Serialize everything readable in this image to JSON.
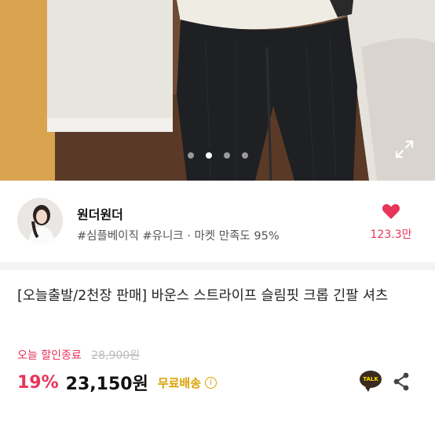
{
  "gallery": {
    "slide_count": 4,
    "active_slide": 2,
    "expand_icon": "expand-icon"
  },
  "seller": {
    "name": "원더원더",
    "tags": "#심플베이직 #유니크 · 마켓 만족도 95%",
    "likes": "123.3만",
    "like_icon": "heart-icon",
    "like_color": "#e8355a"
  },
  "product": {
    "title": "[오늘출발/2천장 판매] 바운스 스트라이프 슬림핏 크롭 긴팔 셔츠",
    "discount_label": "오늘 할인종료",
    "original_price": "28,900원",
    "discount_rate": "19%",
    "price": "23,150원",
    "shipping": "무료배송",
    "shipping_info_icon": "info-icon",
    "talk_label": "TALK",
    "share_icon": "share-icon",
    "accent_color": "#e8355a",
    "shipping_color": "#d8a100"
  }
}
